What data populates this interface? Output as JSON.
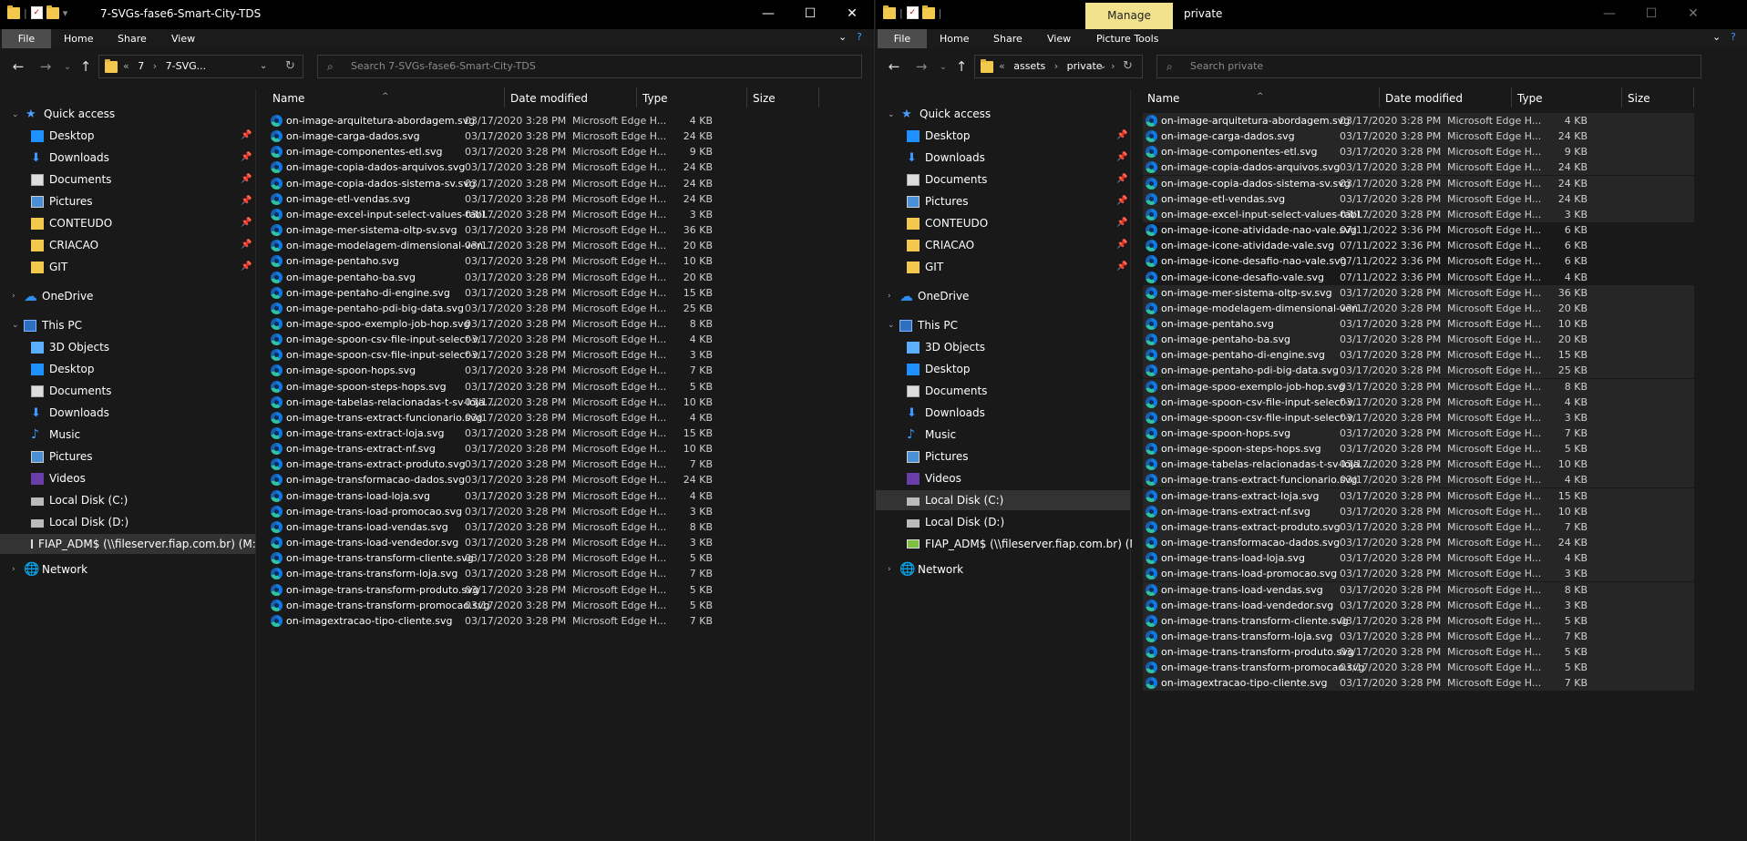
{
  "left": {
    "title": "7-SVGs-fase6-Smart-City-TDS",
    "ribbon_tabs": [
      "File",
      "Home",
      "Share",
      "View"
    ],
    "address": {
      "crumbs": [
        "«",
        "7",
        "›",
        "7-SVG..."
      ]
    },
    "search_placeholder": "Search 7-SVGs-fase6-Smart-City-TDS",
    "nav": {
      "quick_access": "Quick access",
      "qa_items": [
        "Desktop",
        "Downloads",
        "Documents",
        "Pictures",
        "CONTEUDO",
        "CRIACAO",
        "GIT"
      ],
      "onedrive": "OneDrive",
      "this_pc": "This PC",
      "pc_items": [
        "3D Objects",
        "Desktop",
        "Documents",
        "Downloads",
        "Music",
        "Pictures",
        "Videos",
        "Local Disk (C:)",
        "Local Disk (D:)",
        "FIAP_ADM$ (\\\\fileserver.fiap.com.br) (M:)"
      ],
      "network": "Network"
    },
    "columns": [
      "Name",
      "Date modified",
      "Type",
      "Size"
    ],
    "files": [
      [
        "on-image-arquitetura-abordagem.svg",
        "03/17/2020 3:28 PM",
        "Microsoft Edge H...",
        "4 KB"
      ],
      [
        "on-image-carga-dados.svg",
        "03/17/2020 3:28 PM",
        "Microsoft Edge H...",
        "24 KB"
      ],
      [
        "on-image-componentes-etl.svg",
        "03/17/2020 3:28 PM",
        "Microsoft Edge H...",
        "9 KB"
      ],
      [
        "on-image-copia-dados-arquivos.svg",
        "03/17/2020 3:28 PM",
        "Microsoft Edge H...",
        "24 KB"
      ],
      [
        "on-image-copia-dados-sistema-sv.svg",
        "03/17/2020 3:28 PM",
        "Microsoft Edge H...",
        "24 KB"
      ],
      [
        "on-image-etl-vendas.svg",
        "03/17/2020 3:28 PM",
        "Microsoft Edge H...",
        "24 KB"
      ],
      [
        "on-image-excel-input-select-values-tabl...",
        "03/17/2020 3:28 PM",
        "Microsoft Edge H...",
        "3 KB"
      ],
      [
        "on-image-mer-sistema-oltp-sv.svg",
        "03/17/2020 3:28 PM",
        "Microsoft Edge H...",
        "36 KB"
      ],
      [
        "on-image-modelagem-dimensional-ven...",
        "03/17/2020 3:28 PM",
        "Microsoft Edge H...",
        "20 KB"
      ],
      [
        "on-image-pentaho.svg",
        "03/17/2020 3:28 PM",
        "Microsoft Edge H...",
        "10 KB"
      ],
      [
        "on-image-pentaho-ba.svg",
        "03/17/2020 3:28 PM",
        "Microsoft Edge H...",
        "20 KB"
      ],
      [
        "on-image-pentaho-di-engine.svg",
        "03/17/2020 3:28 PM",
        "Microsoft Edge H...",
        "15 KB"
      ],
      [
        "on-image-pentaho-pdi-big-data.svg",
        "03/17/2020 3:28 PM",
        "Microsoft Edge H...",
        "25 KB"
      ],
      [
        "on-image-spoo-exemplo-job-hop.svg",
        "03/17/2020 3:28 PM",
        "Microsoft Edge H...",
        "8 KB"
      ],
      [
        "on-image-spoon-csv-file-input-select-v...",
        "03/17/2020 3:28 PM",
        "Microsoft Edge H...",
        "4 KB"
      ],
      [
        "on-image-spoon-csv-file-input-select-v...",
        "03/17/2020 3:28 PM",
        "Microsoft Edge H...",
        "3 KB"
      ],
      [
        "on-image-spoon-hops.svg",
        "03/17/2020 3:28 PM",
        "Microsoft Edge H...",
        "7 KB"
      ],
      [
        "on-image-spoon-steps-hops.svg",
        "03/17/2020 3:28 PM",
        "Microsoft Edge H...",
        "5 KB"
      ],
      [
        "on-image-tabelas-relacionadas-t-sv-loja....",
        "03/17/2020 3:28 PM",
        "Microsoft Edge H...",
        "10 KB"
      ],
      [
        "on-image-trans-extract-funcionario.svg",
        "03/17/2020 3:28 PM",
        "Microsoft Edge H...",
        "4 KB"
      ],
      [
        "on-image-trans-extract-loja.svg",
        "03/17/2020 3:28 PM",
        "Microsoft Edge H...",
        "15 KB"
      ],
      [
        "on-image-trans-extract-nf.svg",
        "03/17/2020 3:28 PM",
        "Microsoft Edge H...",
        "10 KB"
      ],
      [
        "on-image-trans-extract-produto.svg",
        "03/17/2020 3:28 PM",
        "Microsoft Edge H...",
        "7 KB"
      ],
      [
        "on-image-transformacao-dados.svg",
        "03/17/2020 3:28 PM",
        "Microsoft Edge H...",
        "24 KB"
      ],
      [
        "on-image-trans-load-loja.svg",
        "03/17/2020 3:28 PM",
        "Microsoft Edge H...",
        "4 KB"
      ],
      [
        "on-image-trans-load-promocao.svg",
        "03/17/2020 3:28 PM",
        "Microsoft Edge H...",
        "3 KB"
      ],
      [
        "on-image-trans-load-vendas.svg",
        "03/17/2020 3:28 PM",
        "Microsoft Edge H...",
        "8 KB"
      ],
      [
        "on-image-trans-load-vendedor.svg",
        "03/17/2020 3:28 PM",
        "Microsoft Edge H...",
        "3 KB"
      ],
      [
        "on-image-trans-transform-cliente.svg",
        "03/17/2020 3:28 PM",
        "Microsoft Edge H...",
        "5 KB"
      ],
      [
        "on-image-trans-transform-loja.svg",
        "03/17/2020 3:28 PM",
        "Microsoft Edge H...",
        "7 KB"
      ],
      [
        "on-image-trans-transform-produto.svg",
        "03/17/2020 3:28 PM",
        "Microsoft Edge H...",
        "5 KB"
      ],
      [
        "on-image-trans-transform-promocao.svg",
        "03/17/2020 3:28 PM",
        "Microsoft Edge H...",
        "5 KB"
      ],
      [
        "on-imagextracao-tipo-cliente.svg",
        "03/17/2020 3:28 PM",
        "Microsoft Edge H...",
        "7 KB"
      ]
    ]
  },
  "right": {
    "title": "private",
    "manage_label": "Manage",
    "ribbon_tabs": [
      "File",
      "Home",
      "Share",
      "View",
      "Picture Tools"
    ],
    "address": {
      "crumbs": [
        "«",
        "assets",
        "›",
        "private",
        "›"
      ]
    },
    "search_placeholder": "Search private",
    "nav": {
      "quick_access": "Quick access",
      "qa_items": [
        "Desktop",
        "Downloads",
        "Documents",
        "Pictures",
        "CONTEUDO",
        "CRIACAO",
        "GIT"
      ],
      "onedrive": "OneDrive",
      "this_pc": "This PC",
      "pc_items": [
        "3D Objects",
        "Desktop",
        "Documents",
        "Downloads",
        "Music",
        "Pictures",
        "Videos",
        "Local Disk (C:)",
        "Local Disk (D:)",
        "FIAP_ADM$ (\\\\fileserver.fiap.com.br) (M:)"
      ],
      "network": "Network"
    },
    "columns": [
      "Name",
      "Date modified",
      "Type",
      "Size"
    ],
    "files": [
      [
        "on-image-arquitetura-abordagem.svg",
        "03/17/2020 3:28 PM",
        "Microsoft Edge H...",
        "4 KB"
      ],
      [
        "on-image-carga-dados.svg",
        "03/17/2020 3:28 PM",
        "Microsoft Edge H...",
        "24 KB"
      ],
      [
        "on-image-componentes-etl.svg",
        "03/17/2020 3:28 PM",
        "Microsoft Edge H...",
        "9 KB"
      ],
      [
        "on-image-copia-dados-arquivos.svg",
        "03/17/2020 3:28 PM",
        "Microsoft Edge H...",
        "24 KB"
      ],
      [
        "on-image-copia-dados-sistema-sv.svg",
        "03/17/2020 3:28 PM",
        "Microsoft Edge H...",
        "24 KB"
      ],
      [
        "on-image-etl-vendas.svg",
        "03/17/2020 3:28 PM",
        "Microsoft Edge H...",
        "24 KB"
      ],
      [
        "on-image-excel-input-select-values-tabl...",
        "03/17/2020 3:28 PM",
        "Microsoft Edge H...",
        "3 KB"
      ],
      [
        "on-image-icone-atividade-nao-vale.svg",
        "07/11/2022 3:36 PM",
        "Microsoft Edge H...",
        "6 KB"
      ],
      [
        "on-image-icone-atividade-vale.svg",
        "07/11/2022 3:36 PM",
        "Microsoft Edge H...",
        "6 KB"
      ],
      [
        "on-image-icone-desafio-nao-vale.svg",
        "07/11/2022 3:36 PM",
        "Microsoft Edge H...",
        "6 KB"
      ],
      [
        "on-image-icone-desafio-vale.svg",
        "07/11/2022 3:36 PM",
        "Microsoft Edge H...",
        "4 KB"
      ],
      [
        "on-image-mer-sistema-oltp-sv.svg",
        "03/17/2020 3:28 PM",
        "Microsoft Edge H...",
        "36 KB"
      ],
      [
        "on-image-modelagem-dimensional-ven...",
        "03/17/2020 3:28 PM",
        "Microsoft Edge H...",
        "20 KB"
      ],
      [
        "on-image-pentaho.svg",
        "03/17/2020 3:28 PM",
        "Microsoft Edge H...",
        "10 KB"
      ],
      [
        "on-image-pentaho-ba.svg",
        "03/17/2020 3:28 PM",
        "Microsoft Edge H...",
        "20 KB"
      ],
      [
        "on-image-pentaho-di-engine.svg",
        "03/17/2020 3:28 PM",
        "Microsoft Edge H...",
        "15 KB"
      ],
      [
        "on-image-pentaho-pdi-big-data.svg",
        "03/17/2020 3:28 PM",
        "Microsoft Edge H...",
        "25 KB"
      ],
      [
        "on-image-spoo-exemplo-job-hop.svg",
        "03/17/2020 3:28 PM",
        "Microsoft Edge H...",
        "8 KB"
      ],
      [
        "on-image-spoon-csv-file-input-select-v...",
        "03/17/2020 3:28 PM",
        "Microsoft Edge H...",
        "4 KB"
      ],
      [
        "on-image-spoon-csv-file-input-select-v...",
        "03/17/2020 3:28 PM",
        "Microsoft Edge H...",
        "3 KB"
      ],
      [
        "on-image-spoon-hops.svg",
        "03/17/2020 3:28 PM",
        "Microsoft Edge H...",
        "7 KB"
      ],
      [
        "on-image-spoon-steps-hops.svg",
        "03/17/2020 3:28 PM",
        "Microsoft Edge H...",
        "5 KB"
      ],
      [
        "on-image-tabelas-relacionadas-t-sv-loja....",
        "03/17/2020 3:28 PM",
        "Microsoft Edge H...",
        "10 KB"
      ],
      [
        "on-image-trans-extract-funcionario.svg",
        "03/17/2020 3:28 PM",
        "Microsoft Edge H...",
        "4 KB"
      ],
      [
        "on-image-trans-extract-loja.svg",
        "03/17/2020 3:28 PM",
        "Microsoft Edge H...",
        "15 KB"
      ],
      [
        "on-image-trans-extract-nf.svg",
        "03/17/2020 3:28 PM",
        "Microsoft Edge H...",
        "10 KB"
      ],
      [
        "on-image-trans-extract-produto.svg",
        "03/17/2020 3:28 PM",
        "Microsoft Edge H...",
        "7 KB"
      ],
      [
        "on-image-transformacao-dados.svg",
        "03/17/2020 3:28 PM",
        "Microsoft Edge H...",
        "24 KB"
      ],
      [
        "on-image-trans-load-loja.svg",
        "03/17/2020 3:28 PM",
        "Microsoft Edge H...",
        "4 KB"
      ],
      [
        "on-image-trans-load-promocao.svg",
        "03/17/2020 3:28 PM",
        "Microsoft Edge H...",
        "3 KB"
      ],
      [
        "on-image-trans-load-vendas.svg",
        "03/17/2020 3:28 PM",
        "Microsoft Edge H...",
        "8 KB"
      ],
      [
        "on-image-trans-load-vendedor.svg",
        "03/17/2020 3:28 PM",
        "Microsoft Edge H...",
        "3 KB"
      ],
      [
        "on-image-trans-transform-cliente.svg",
        "03/17/2020 3:28 PM",
        "Microsoft Edge H...",
        "5 KB"
      ],
      [
        "on-image-trans-transform-loja.svg",
        "03/17/2020 3:28 PM",
        "Microsoft Edge H...",
        "7 KB"
      ],
      [
        "on-image-trans-transform-produto.svg",
        "03/17/2020 3:28 PM",
        "Microsoft Edge H...",
        "5 KB"
      ],
      [
        "on-image-trans-transform-promocao.svg",
        "03/17/2020 3:28 PM",
        "Microsoft Edge H...",
        "5 KB"
      ],
      [
        "on-imagextracao-tipo-cliente.svg",
        "03/17/2020 3:28 PM",
        "Microsoft Edge H...",
        "7 KB"
      ]
    ]
  },
  "colors": {
    "manage_tab": "#f2e18d",
    "file_tab": "#4c4c4c",
    "selected": "#333333",
    "background": "#191919"
  }
}
